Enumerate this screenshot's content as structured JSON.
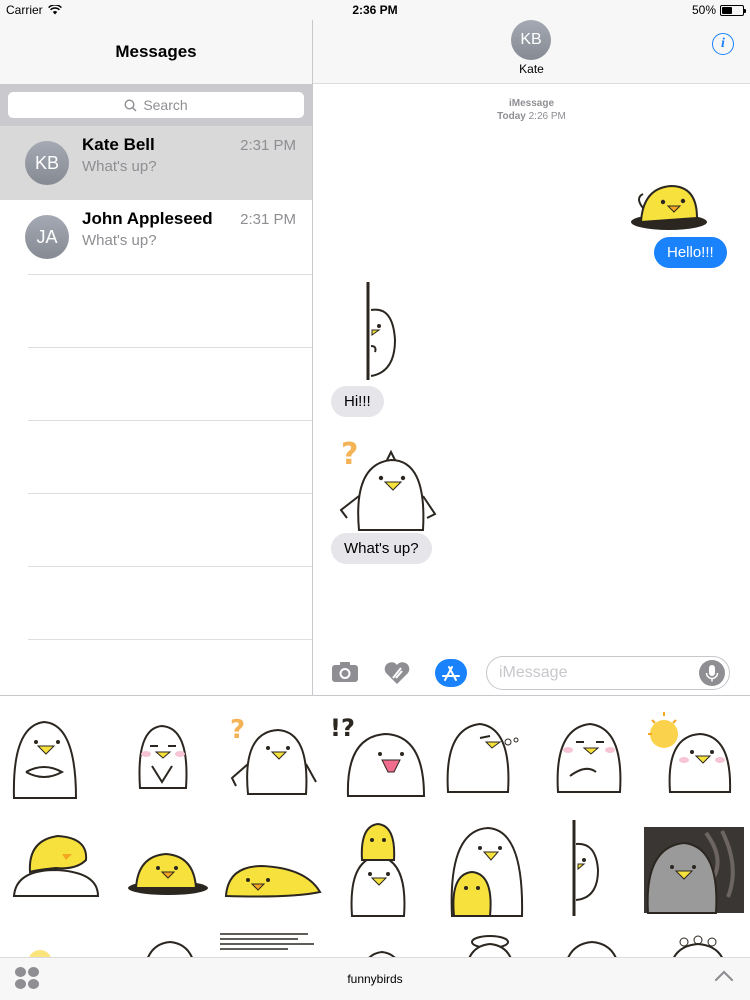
{
  "status_bar": {
    "carrier": "Carrier",
    "time": "2:36 PM",
    "battery": "50%",
    "battery_level": 0.5
  },
  "sidebar": {
    "title": "Messages",
    "search_placeholder": "Search",
    "conversations": [
      {
        "initials": "KB",
        "name": "Kate Bell",
        "preview": "What's up?",
        "time": "2:31 PM",
        "selected": true
      },
      {
        "initials": "JA",
        "name": "John Appleseed",
        "preview": "What's up?",
        "time": "2:31 PM",
        "selected": false
      }
    ]
  },
  "chat_header": {
    "initials": "KB",
    "name": "Kate"
  },
  "chat": {
    "service": "iMessage",
    "timestamp_day": "Today",
    "timestamp_time": "2:26 PM",
    "messages": [
      {
        "direction": "outgoing",
        "text": "Hello!!!"
      },
      {
        "direction": "incoming",
        "text": "Hi!!!"
      },
      {
        "direction": "incoming",
        "text": "What's up?"
      }
    ]
  },
  "input": {
    "placeholder": "iMessage"
  },
  "app_drawer": {
    "app_name": "funnybirds"
  },
  "colors": {
    "accent": "#1a82fb",
    "incoming_bubble": "#e5e5ea",
    "bird_yellow": "#f7e13c"
  }
}
